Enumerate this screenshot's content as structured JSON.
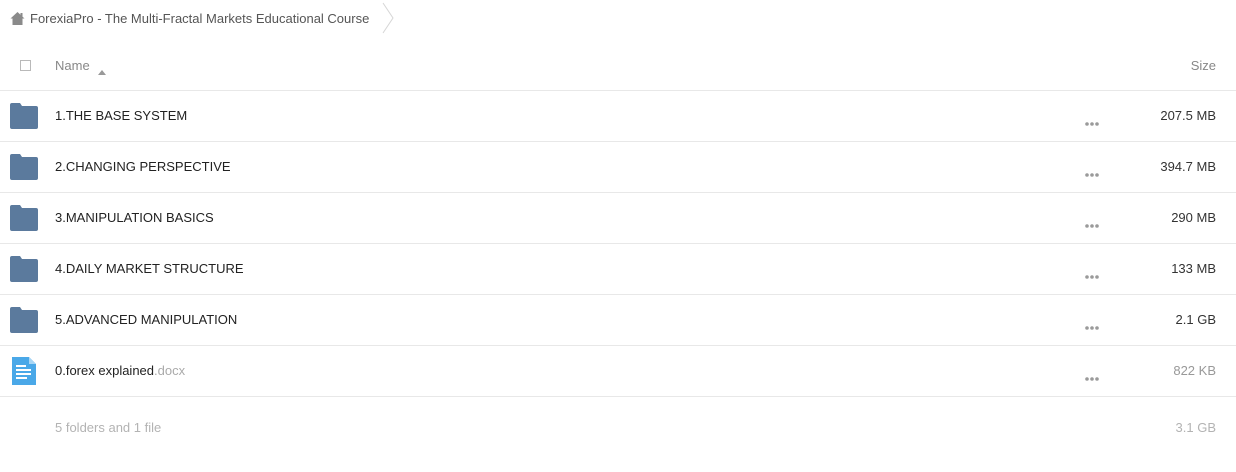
{
  "breadcrumb": {
    "title": "ForexiaPro - The Multi-Fractal Markets Educational Course"
  },
  "table": {
    "columns": {
      "name": "Name",
      "size": "Size"
    },
    "items": [
      {
        "name": "1.THE BASE SYSTEM",
        "ext": "",
        "size": "207.5 MB",
        "type": "folder"
      },
      {
        "name": "2.CHANGING PERSPECTIVE",
        "ext": "",
        "size": "394.7 MB",
        "type": "folder"
      },
      {
        "name": "3.MANIPULATION BASICS",
        "ext": "",
        "size": "290 MB",
        "type": "folder"
      },
      {
        "name": "4.DAILY MARKET STRUCTURE",
        "ext": "",
        "size": "133 MB",
        "type": "folder"
      },
      {
        "name": "5.ADVANCED MANIPULATION",
        "ext": "",
        "size": "2.1 GB",
        "type": "folder"
      },
      {
        "name": "0.forex explained",
        "ext": ".docx",
        "size": "822 KB",
        "type": "document"
      }
    ]
  },
  "footer": {
    "summary": "5 folders and 1 file",
    "total": "3.1 GB"
  },
  "colors": {
    "folder": "#5b7a9d",
    "document": "#4aa8e8",
    "divider": "#e8e8e8"
  },
  "icons": {
    "home": "home-icon",
    "separator": "chevron-right-icon",
    "sort": "sort-ascending-icon",
    "folder": "folder-icon",
    "document": "document-icon",
    "menu": "more-options-icon"
  }
}
